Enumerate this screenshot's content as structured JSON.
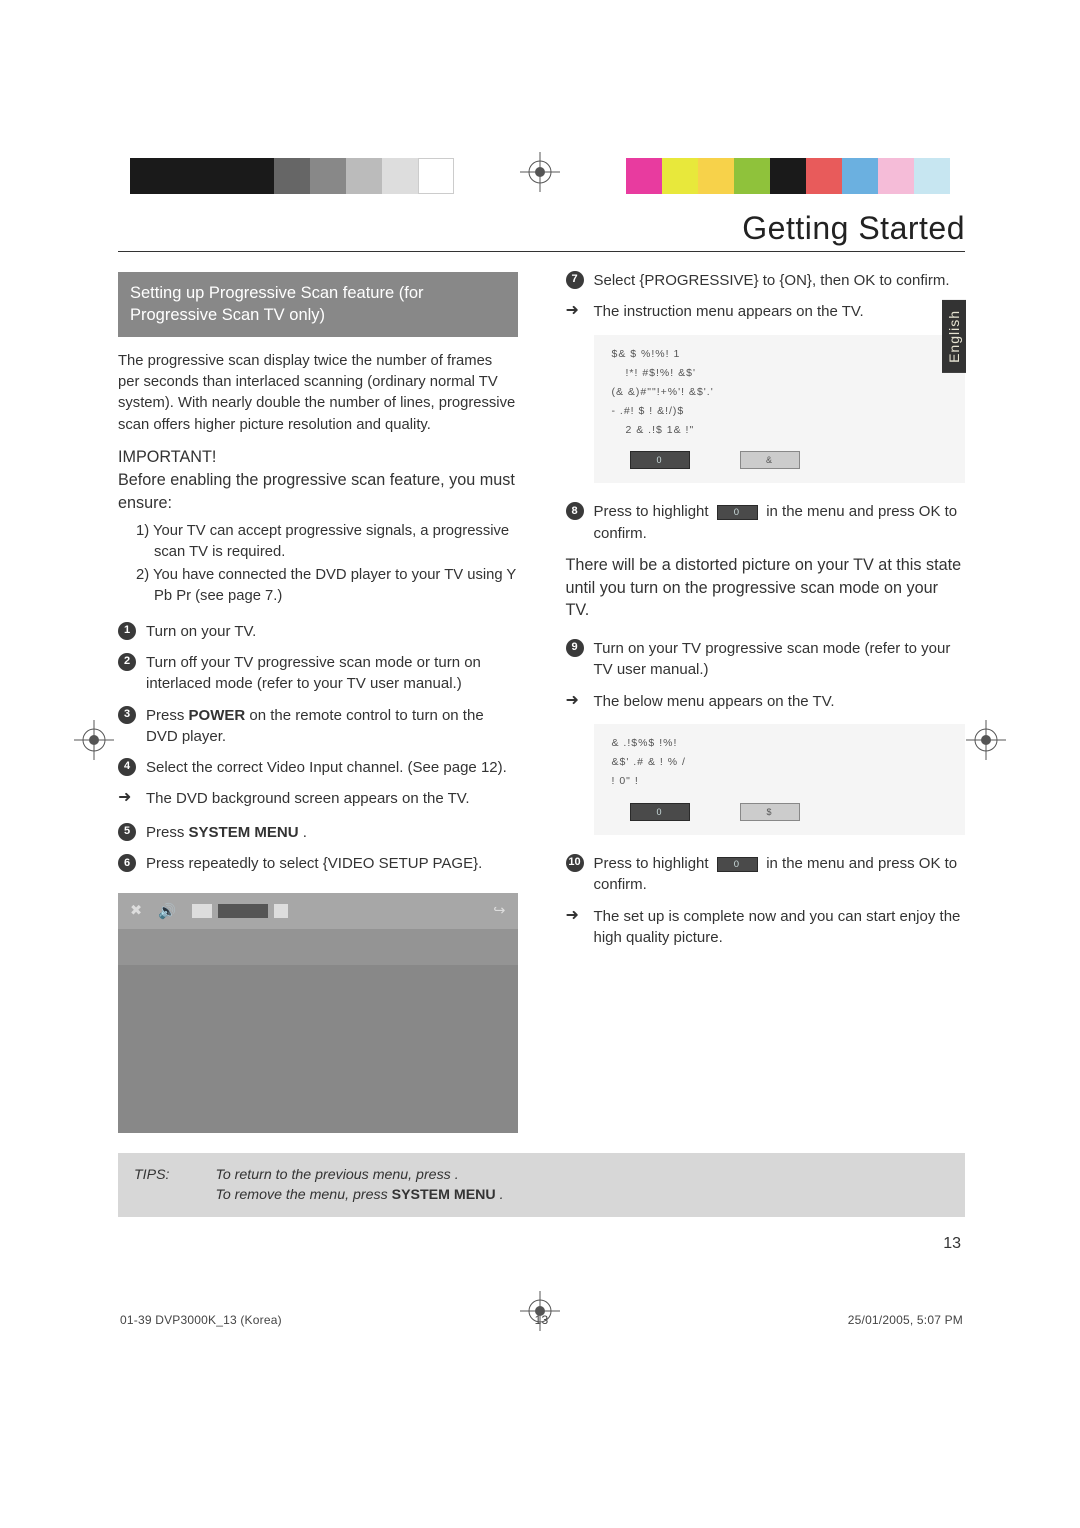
{
  "title": "Getting Started",
  "langtab": "English",
  "section_heading": "Setting up Progressive Scan feature (for Progressive Scan TV only)",
  "intro": "The progressive scan display twice the number of frames per seconds than interlaced scanning (ordinary normal TV system). With nearly double the number of lines, progressive scan offers higher picture resolution and quality.",
  "important_label": "IMPORTANT!",
  "important_text": "Before enabling the progressive scan feature, you must ensure:",
  "pre1": "1) Your TV can accept progressive signals, a progressive scan TV is required.",
  "pre2": "2) You have connected the DVD player to your TV using Y Pb Pr (see page 7.)",
  "step1": "Turn on your TV.",
  "step2": "Turn off your TV progressive scan mode or turn on interlaced mode (refer to your TV user manual.)",
  "step3_a": "Press ",
  "step3_b": "POWER",
  "step3_c": " on the remote control to turn on the DVD player.",
  "step4_a": "Select the correct Video Input channel. (See page 12).",
  "step4_arrow": "The DVD background screen appears on the TV.",
  "step5_a": "Press ",
  "step5_b": "SYSTEM MENU",
  "step5_c": " .",
  "step6_a": "Press   repeatedly to select {VIDEO SETUP PAGE}.",
  "step7_a": "Select {PROGRESSIVE} to {ON}, then OK to confirm.",
  "step7_arrow": "The instruction menu appears on the TV.",
  "step8_a": "Press   to highlight ",
  "step8_b": " in the menu and press OK to confirm.",
  "step8_note": "There will be a distorted picture on your TV at this state until you turn on the progressive scan mode on your TV.",
  "step9_a": "Turn on your TV progressive scan mode (refer to your TV user manual.)",
  "step9_arrow": "The below menu appears on the TV.",
  "step10_a": "Press   to highlight ",
  "step10_b": " in the menu and press OK to confirm.",
  "step10_arrow": "The set up is complete now and you can start enjoy the high quality picture.",
  "ok_label": "0",
  "tvbox1": {
    "l1": "$& $ %!%! 1",
    "l2": "!*! #$!%!   &$'",
    "l3": "(&  &)#\"\"!+%'!   &$'.'",
    "l4": "- .#! $  !  &!/)$",
    "l5": "2 &  .!$ 1& !\"",
    "btn1": "0",
    "btn2": "&"
  },
  "tvbox2": {
    "l1": "& .!$%$    !%!",
    "l2": "&$' .# & !  % /",
    "l3": "! 0\"  !",
    "btn1": "0",
    "btn2": "$"
  },
  "tips_label": "TIPS:",
  "tips_l1_a": "To return to the previous menu, press  .",
  "tips_l2_a": "To remove the menu, press ",
  "tips_l2_b": "SYSTEM MENU",
  "tips_l2_c": " .",
  "page_number": "13",
  "footer_left": "01-39 DVP3000K_13 (Korea)",
  "footer_center": "13",
  "footer_right": "25/01/2005, 5:07 PM",
  "colorbar_left": [
    "#1a1a1a",
    "#1a1a1a",
    "#1a1a1a",
    "#1a1a1a",
    "#666",
    "#888",
    "#bbb",
    "#ddd",
    "#fff"
  ],
  "colorbar_right": [
    "#e83b9f",
    "#e8e83b",
    "#f7d24a",
    "#8fc23b",
    "#1a1a1a",
    "#e85b5b",
    "#6bb0e0",
    "#f5bcd8",
    "#c7e6f1"
  ]
}
